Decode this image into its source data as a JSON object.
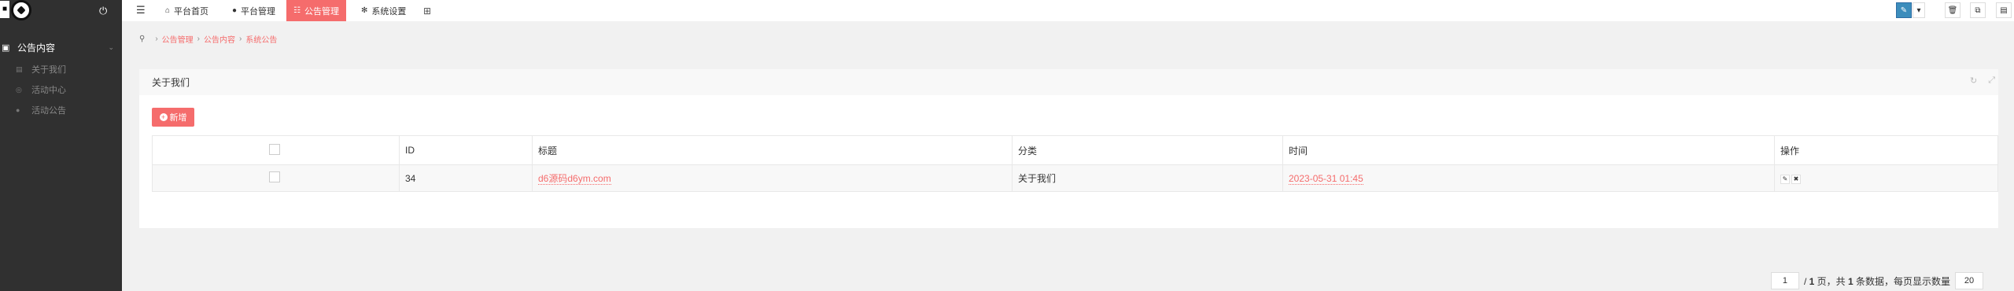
{
  "sidebar": {
    "section_label": "公告内容",
    "items": [
      {
        "label": "关于我们",
        "icon": "calendar-icon"
      },
      {
        "label": "活动中心",
        "icon": "circle-icon"
      },
      {
        "label": "活动公告",
        "icon": "user-icon"
      }
    ]
  },
  "topnav": {
    "tabs": [
      {
        "label": "平台首页",
        "icon": "home-icon"
      },
      {
        "label": "平台管理",
        "icon": "user-icon"
      },
      {
        "label": "公告管理",
        "icon": "list-icon",
        "active": true
      },
      {
        "label": "系统设置",
        "icon": "gear-icon"
      }
    ]
  },
  "breadcrumb": [
    "公告管理",
    "公告内容",
    "系统公告"
  ],
  "panel": {
    "title": "关于我们",
    "add_label": "新增"
  },
  "table": {
    "headers": [
      "ID",
      "标题",
      "分类",
      "时间",
      "操作"
    ],
    "rows": [
      {
        "id": "34",
        "title": "d6源码d6ym.com",
        "category": "关于我们",
        "time": "2023-05-31 01:45"
      }
    ]
  },
  "pager": {
    "page": "1",
    "text_pre": "/ ",
    "total_pages": "1",
    "text_mid": " 页，共 ",
    "total_rows": "1",
    "text_post": " 条数据，每页显示数量",
    "page_size": "20"
  },
  "colors": {
    "accent": "#f56c6c",
    "sidebar_bg": "#303030",
    "top_blue": "#3c8dbc"
  }
}
